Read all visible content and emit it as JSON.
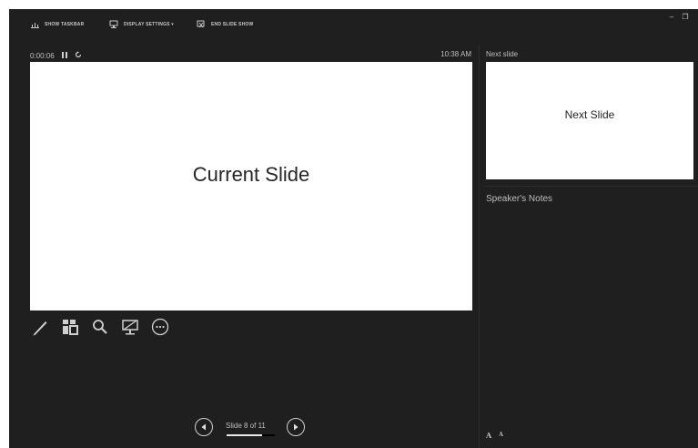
{
  "toolbar": {
    "show_taskbar": "SHOW TASKBAR",
    "display_settings": "DISPLAY SETTINGS ▾",
    "end_slide_show": "END SLIDE SHOW",
    "minimize": "–",
    "restore": "❐"
  },
  "presenter": {
    "elapsed_time": "0:00:06",
    "clock": "10:38 AM",
    "current_slide_text": "Current Slide"
  },
  "tools": [
    {
      "name": "pen-icon"
    },
    {
      "name": "see-all-slides-icon"
    },
    {
      "name": "zoom-icon"
    },
    {
      "name": "black-screen-icon"
    },
    {
      "name": "more-options-icon"
    }
  ],
  "next": {
    "label": "Next slide",
    "slide_text": "Next Slide"
  },
  "notes": {
    "label": "Speaker's Notes"
  },
  "font_controls": {
    "increase": "A",
    "decrease": "A"
  },
  "navigation": {
    "slide_counter": "Slide 8 of 11",
    "current": 8,
    "total": 11,
    "progress": 0.727
  },
  "colors": {
    "background": "#1f1f1f",
    "slide": "#ffffff",
    "text": "#bfbfbf"
  }
}
